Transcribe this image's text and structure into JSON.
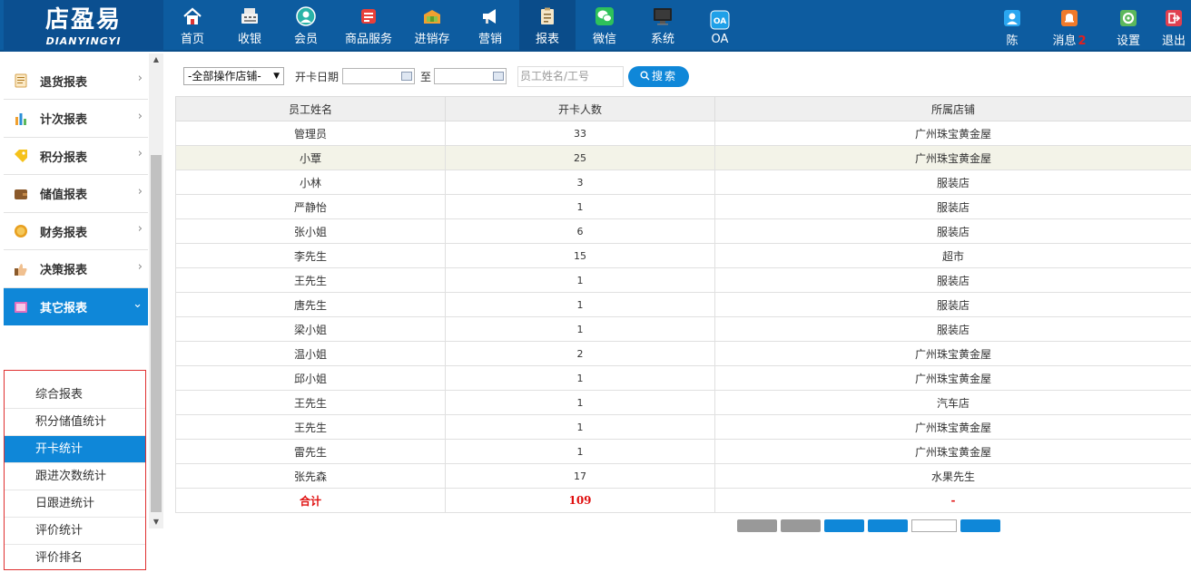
{
  "app": {
    "logo_cn": "店盈易",
    "logo_en": "DIANYINGYI"
  },
  "nav": [
    {
      "label": "首页",
      "icon": "home-icon"
    },
    {
      "label": "收银",
      "icon": "cash-register-icon"
    },
    {
      "label": "会员",
      "icon": "member-icon"
    },
    {
      "label": "商品服务",
      "icon": "product-service-icon"
    },
    {
      "label": "进销存",
      "icon": "inventory-icon"
    },
    {
      "label": "营销",
      "icon": "marketing-icon"
    },
    {
      "label": "报表",
      "icon": "report-icon",
      "active": true
    },
    {
      "label": "微信",
      "icon": "wechat-icon"
    },
    {
      "label": "系统",
      "icon": "system-icon"
    },
    {
      "label": "OA",
      "icon": "oa-icon"
    }
  ],
  "right_nav": {
    "user": "陈",
    "messages": "消息",
    "message_count": "2",
    "settings": "设置",
    "logout": "退出"
  },
  "sidebar": {
    "items": [
      {
        "label": "退货报表"
      },
      {
        "label": "计次报表"
      },
      {
        "label": "积分报表"
      },
      {
        "label": "储值报表"
      },
      {
        "label": "财务报表"
      },
      {
        "label": "决策报表"
      },
      {
        "label": "其它报表",
        "open": true
      }
    ],
    "subitems": [
      {
        "label": "综合报表"
      },
      {
        "label": "积分储值统计"
      },
      {
        "label": "开卡统计",
        "active": true
      },
      {
        "label": "跟进次数统计"
      },
      {
        "label": "日跟进统计"
      },
      {
        "label": "评价统计"
      },
      {
        "label": "评价排名"
      }
    ]
  },
  "filters": {
    "store_select": "-全部操作店铺-",
    "open_date_label": "开卡日期",
    "to_label": "至",
    "staff_placeholder": "员工姓名/工号",
    "search_label": "搜索"
  },
  "table": {
    "columns": [
      "员工姓名",
      "开卡人数",
      "所属店铺"
    ],
    "rows": [
      [
        "管理员",
        "33",
        "广州珠宝黄金屋"
      ],
      [
        "小覃",
        "25",
        "广州珠宝黄金屋"
      ],
      [
        "小林",
        "3",
        "服装店"
      ],
      [
        "严静怡",
        "1",
        "服装店"
      ],
      [
        "张小姐",
        "6",
        "服装店"
      ],
      [
        "李先生",
        "15",
        "超市"
      ],
      [
        "王先生",
        "1",
        "服装店"
      ],
      [
        "唐先生",
        "1",
        "服装店"
      ],
      [
        "梁小姐",
        "1",
        "服装店"
      ],
      [
        "温小姐",
        "2",
        "广州珠宝黄金屋"
      ],
      [
        "邱小姐",
        "1",
        "广州珠宝黄金屋"
      ],
      [
        "王先生",
        "1",
        "汽车店"
      ],
      [
        "王先生",
        "1",
        "广州珠宝黄金屋"
      ],
      [
        "雷先生",
        "1",
        "广州珠宝黄金屋"
      ],
      [
        "张先森",
        "17",
        "水果先生"
      ]
    ],
    "highlight_row": 1,
    "total": [
      "合计",
      "109",
      "-"
    ]
  },
  "colors": {
    "topbar": "#0d5ca0",
    "accent": "#0f87d8",
    "total_red": "#e01010"
  }
}
